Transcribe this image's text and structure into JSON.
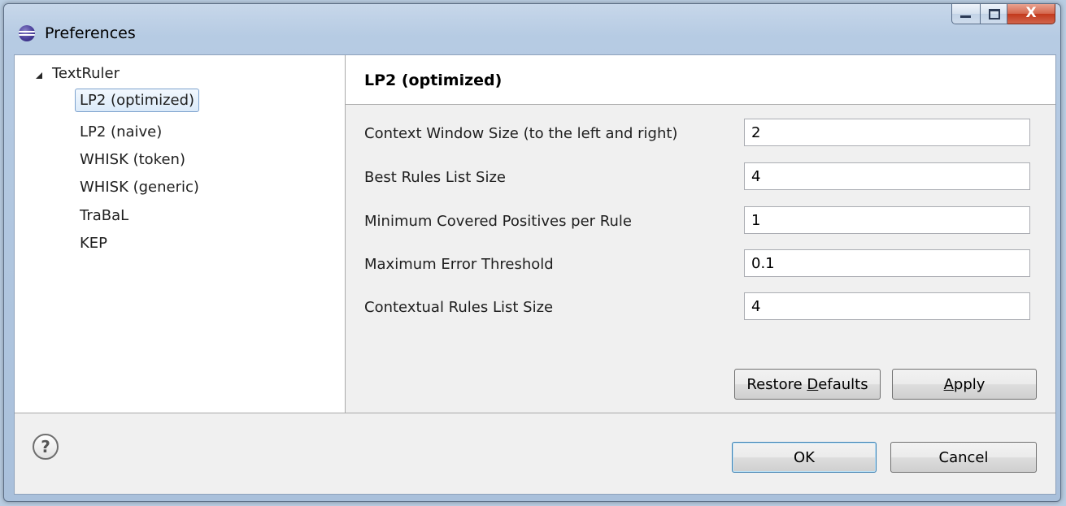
{
  "window": {
    "title": "Preferences",
    "close_glyph": "X"
  },
  "tree": {
    "root": "TextRuler",
    "items": [
      {
        "label": "LP2 (optimized)",
        "selected": true
      },
      {
        "label": "LP2 (naive)"
      },
      {
        "label": "WHISK (token)"
      },
      {
        "label": "WHISK (generic)"
      },
      {
        "label": "TraBaL"
      },
      {
        "label": "KEP"
      }
    ]
  },
  "page": {
    "title": "LP2 (optimized)",
    "fields": [
      {
        "label": "Context Window Size (to the left and right)",
        "value": "2"
      },
      {
        "label": "Best Rules List Size",
        "value": "4"
      },
      {
        "label": "Minimum Covered Positives per Rule",
        "value": "1"
      },
      {
        "label": "Maximum Error Threshold",
        "value": "0.1"
      },
      {
        "label": "Contextual Rules List Size",
        "value": "4"
      }
    ],
    "restore_defaults": {
      "before": "Restore ",
      "mnemonic": "D",
      "after": "efaults"
    },
    "apply": {
      "before": "",
      "mnemonic": "A",
      "after": "pply"
    }
  },
  "footer": {
    "help_glyph": "?",
    "ok_label": "OK",
    "cancel_label": "Cancel"
  },
  "colors": {
    "frame": "#b6cbe3",
    "selection_border": "#7da2ce",
    "close_button": "#c2391c"
  }
}
